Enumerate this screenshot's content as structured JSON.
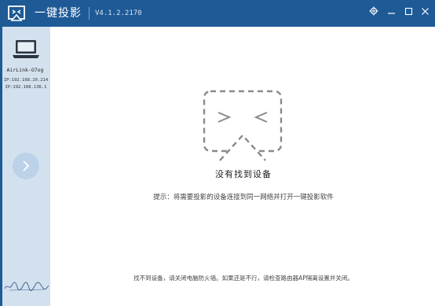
{
  "app": {
    "title": "一键投影",
    "version": "V4.1.2.2170"
  },
  "window_controls": {
    "settings_icon": "gear-icon",
    "minimize_icon": "minimize-icon",
    "maximize_icon": "maximize-icon",
    "close_icon": "close-icon"
  },
  "sidebar": {
    "device": {
      "name": "AirLink-O7og",
      "ip1": "IP:192.168.20.214",
      "ip2": "IP:192.168.136.1",
      "icon": "laptop-icon"
    },
    "next_icon": "chevron-right-icon",
    "signature_icon": "signature"
  },
  "main": {
    "empty_title": "没有找到设备",
    "hint": "提示：将需要投影的设备连接到同一网络并打开一键投影软件",
    "footer": "找不到设备，请关闭电脑防火墙。如果还是不行，请检查路由器AP隔离设置并关闭。"
  },
  "colors": {
    "titlebar": "#1e5a96",
    "sidebar": "#d3e1ef",
    "placeholder": "#8a8a8a"
  }
}
